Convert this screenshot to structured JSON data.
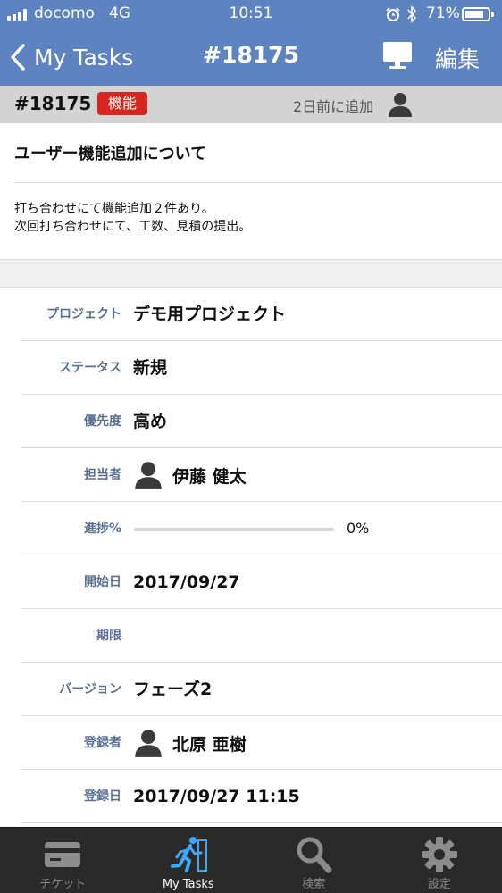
{
  "status_bar": {
    "carrier": "docomo",
    "network": "4G",
    "time": "10:51",
    "battery": "71%",
    "battery_level": 0.71
  },
  "nav": {
    "back_label": "My Tasks",
    "title": "#18175",
    "edit_label": "編集"
  },
  "issue": {
    "id": "#18175",
    "tracker": "機能",
    "added": "2日前に追加",
    "subject": "ユーザー機能追加について",
    "description": [
      "打ち合わせにて機能追加２件あり。",
      "次回打ち合わせにて、工数、見積の提出。"
    ]
  },
  "attributes": {
    "project": {
      "label": "プロジェクト",
      "value": "デモ用プロジェクト"
    },
    "status": {
      "label": "ステータス",
      "value": "新規"
    },
    "priority": {
      "label": "優先度",
      "value": "高め"
    },
    "assignee": {
      "label": "担当者",
      "value": "伊藤 健太"
    },
    "progress": {
      "label": "進捗%",
      "value": "0%",
      "fraction": 0
    },
    "start_date": {
      "label": "開始日",
      "value": "2017/09/27"
    },
    "due_date": {
      "label": "期限",
      "value": ""
    },
    "version": {
      "label": "バージョン",
      "value": "フェーズ2"
    },
    "author": {
      "label": "登録者",
      "value": "北原 亜樹"
    },
    "created": {
      "label": "登録日",
      "value": "2017/09/27 11:15"
    }
  },
  "tabs": [
    {
      "label": "チケット",
      "icon": "ticket-card-icon",
      "active": false
    },
    {
      "label": "My Tasks",
      "icon": "running-person-icon",
      "active": true
    },
    {
      "label": "検索",
      "icon": "search-icon",
      "active": false
    },
    {
      "label": "設定",
      "icon": "gear-icon",
      "active": false
    }
  ],
  "colors": {
    "nav_bar": "#5d84c0",
    "tracker_badge": "#d6261f",
    "field_label": "#5a6f94",
    "tab_bar": "#2a2a2a",
    "active_tab_icon": "#3fa9f5"
  }
}
